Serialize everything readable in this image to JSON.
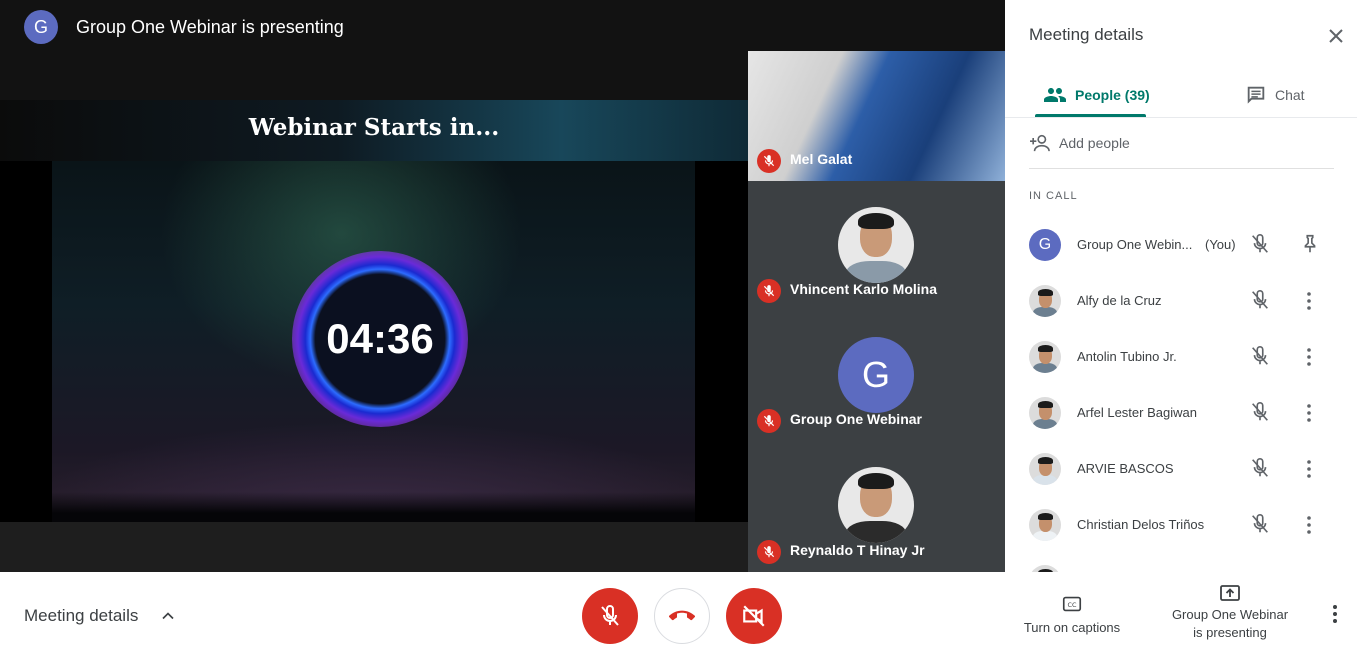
{
  "stage": {
    "presenter_initial": "G",
    "presenter_text": "Group One Webinar is presenting",
    "slide_title": "Webinar Starts in...",
    "countdown": "04:36"
  },
  "tiles": [
    {
      "name": "Mel Galat",
      "muted": true,
      "kind": "video"
    },
    {
      "name": "Vhincent Karlo Molina",
      "muted": true,
      "kind": "photo"
    },
    {
      "name": "Group One Webinar",
      "muted": true,
      "kind": "initial",
      "initial": "G"
    },
    {
      "name": "Reynaldo T Hinay Jr",
      "muted": true,
      "kind": "photo"
    }
  ],
  "panel": {
    "title": "Meeting details",
    "tabs": {
      "people": "People (39)",
      "chat": "Chat"
    },
    "add_people": "Add people",
    "section_label": "IN CALL",
    "people": [
      {
        "name": "Group One Webin...",
        "you": "(You)",
        "initial": "G"
      },
      {
        "name": "Alfy de la Cruz"
      },
      {
        "name": "Antolin Tubino Jr."
      },
      {
        "name": "Arfel Lester Bagiwan"
      },
      {
        "name": "ARVIE BASCOS"
      },
      {
        "name": "Christian Delos Triños"
      }
    ]
  },
  "bottom_bar": {
    "meeting_details": "Meeting details",
    "captions": "Turn on captions",
    "presenting_line1": "Group One Webinar",
    "presenting_line2": "is presenting"
  },
  "colors": {
    "accent": "#00796b",
    "danger": "#d93025",
    "avatar": "#5c6bc0"
  }
}
